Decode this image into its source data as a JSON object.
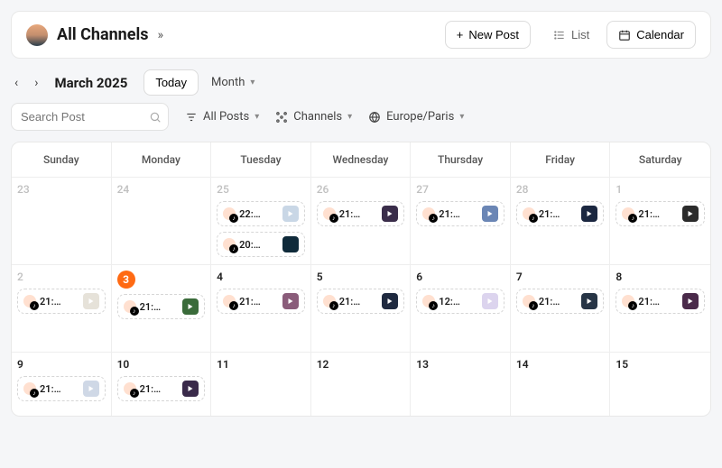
{
  "header": {
    "title": "All Channels",
    "new_post_label": "New Post",
    "list_label": "List",
    "calendar_label": "Calendar"
  },
  "toolbar": {
    "month_label": "March 2025",
    "today_label": "Today",
    "range_label": "Month"
  },
  "filters": {
    "search_placeholder": "Search Post",
    "all_posts_label": "All Posts",
    "channels_label": "Channels",
    "timezone_label": "Europe/Paris"
  },
  "weekdays": [
    "Sunday",
    "Monday",
    "Tuesday",
    "Wednesday",
    "Thursday",
    "Friday",
    "Saturday"
  ],
  "weeks": [
    [
      {
        "num": "23",
        "muted": true,
        "events": []
      },
      {
        "num": "24",
        "muted": true,
        "events": []
      },
      {
        "num": "25",
        "muted": true,
        "events": [
          {
            "time": "22:…",
            "thumb": "#c9d7e6",
            "play": true
          },
          {
            "time": "20:…",
            "thumb": "#0f2a3a",
            "play": false
          }
        ]
      },
      {
        "num": "26",
        "muted": true,
        "events": [
          {
            "time": "21:…",
            "thumb": "#3a2d4a",
            "play": true
          }
        ]
      },
      {
        "num": "27",
        "muted": true,
        "events": [
          {
            "time": "21:…",
            "thumb": "#6b86b5",
            "play": true
          }
        ]
      },
      {
        "num": "28",
        "muted": true,
        "events": [
          {
            "time": "21:…",
            "thumb": "#1b2740",
            "play": true
          }
        ]
      },
      {
        "num": "1",
        "muted": true,
        "events": [
          {
            "time": "21:…",
            "thumb": "#2b2b2b",
            "play": true
          }
        ]
      }
    ],
    [
      {
        "num": "2",
        "muted": true,
        "events": [
          {
            "time": "21:…",
            "thumb": "#e6e2d9",
            "play": true
          }
        ]
      },
      {
        "num": "3",
        "today": true,
        "events": [
          {
            "time": "21:…",
            "thumb": "#3a6b3a",
            "play": true
          }
        ]
      },
      {
        "num": "4",
        "events": [
          {
            "time": "21:…",
            "thumb": "#8a5c7a",
            "play": true
          }
        ]
      },
      {
        "num": "5",
        "events": [
          {
            "time": "21:…",
            "thumb": "#1f2a40",
            "play": true
          }
        ]
      },
      {
        "num": "6",
        "events": [
          {
            "time": "12:…",
            "thumb": "#dcd4ee",
            "play": true
          }
        ]
      },
      {
        "num": "7",
        "events": [
          {
            "time": "21:…",
            "thumb": "#273546",
            "play": true
          }
        ]
      },
      {
        "num": "8",
        "events": [
          {
            "time": "21:…",
            "thumb": "#4a2a4a",
            "play": true
          }
        ]
      }
    ],
    [
      {
        "num": "9",
        "events": [
          {
            "time": "21:…",
            "thumb": "#cfd8e6",
            "play": true
          }
        ]
      },
      {
        "num": "10",
        "events": [
          {
            "time": "21:…",
            "thumb": "#3a2a4a",
            "play": true
          }
        ]
      },
      {
        "num": "11",
        "events": []
      },
      {
        "num": "12",
        "events": []
      },
      {
        "num": "13",
        "events": []
      },
      {
        "num": "14",
        "events": []
      },
      {
        "num": "15",
        "events": []
      }
    ]
  ]
}
